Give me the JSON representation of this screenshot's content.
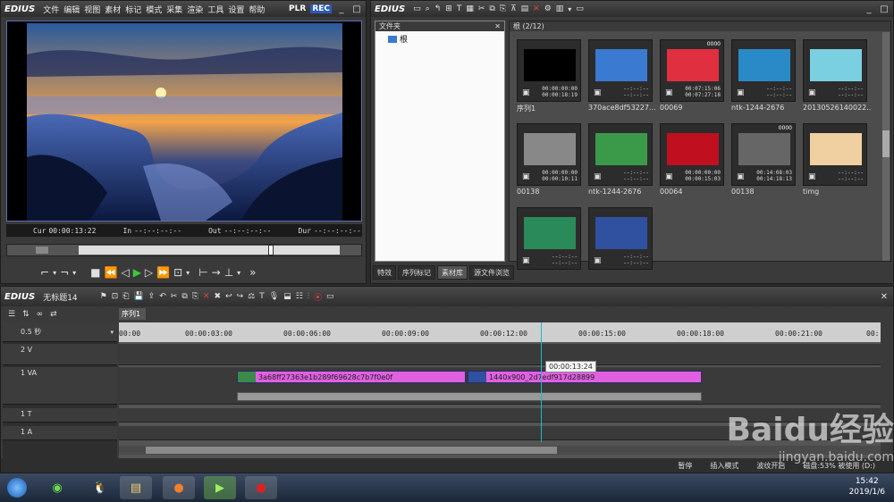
{
  "player": {
    "brand": "EDIUS",
    "menu": [
      "文件",
      "编辑",
      "视图",
      "素材",
      "标记",
      "模式",
      "采集",
      "渲染",
      "工具",
      "设置",
      "帮助"
    ],
    "plr": "PLR",
    "rec": "REC",
    "cur_label": "Cur",
    "cur_value": "00:00:13:22",
    "in_label": "In",
    "in_value": "--:--:--:--",
    "out_label": "Out",
    "out_value": "--:--:--:--",
    "dur_label": "Dur",
    "dur_value": "--:--:--:--"
  },
  "bin": {
    "brand": "EDIUS",
    "folder_header": "文件夹",
    "root_label": "根",
    "bin_header": "根 (2/12)",
    "clips": [
      {
        "name": "序列1",
        "tc1": "00:00:00:00",
        "tc2": "00:00:18:19",
        "corner": ""
      },
      {
        "name": "370ace8df53227...",
        "tc1": "--:--:--",
        "tc2": "--:--:--",
        "corner": ""
      },
      {
        "name": "00069",
        "tc1": "00:07:15:06",
        "tc2": "00:07:27:18",
        "corner": "0000"
      },
      {
        "name": "ntk-1244-2676",
        "tc1": "--:--:--",
        "tc2": "--:--:--",
        "corner": ""
      },
      {
        "name": "20130526140022...",
        "tc1": "--:--:--",
        "tc2": "--:--:--",
        "corner": ""
      },
      {
        "name": "00138",
        "tc1": "00:00:00:00",
        "tc2": "00:00:10:11",
        "corner": ""
      },
      {
        "name": "ntk-1244-2676",
        "tc1": "--:--:--",
        "tc2": "--:--:--",
        "corner": ""
      },
      {
        "name": "00064",
        "tc1": "00:00:00:00",
        "tc2": "00:00:15:03",
        "corner": ""
      },
      {
        "name": "00138",
        "tc1": "00:14:08:03",
        "tc2": "00:14:18:13",
        "corner": "0000"
      },
      {
        "name": "timg",
        "tc1": "--:--:--",
        "tc2": "--:--:--",
        "corner": ""
      },
      {
        "name": "",
        "tc1": "--:--:--",
        "tc2": "--:--:--",
        "corner": ""
      },
      {
        "name": "",
        "tc1": "--:--:--",
        "tc2": "--:--:--",
        "corner": ""
      }
    ],
    "tabs": [
      "特效",
      "序列标记",
      "素材库",
      "源文件浏览"
    ]
  },
  "timeline": {
    "brand": "EDIUS",
    "project": "无标题14",
    "sequence_tab": "序列1",
    "zoom": "0.5 秒",
    "ruler": [
      "00:00",
      "00:00:03:00",
      "00:00:06:00",
      "00:00:09:00",
      "00:00:12:00",
      "00:00:15:00",
      "00:00:18:00",
      "00:00:21:00",
      "00:"
    ],
    "tracks": [
      "2 V",
      "1 VA",
      "1 T",
      "1 A"
    ],
    "clip1": "3a68ff27363e1b289f69628c7b7f0e0f",
    "clip2": "1440x900_2d7edf917d28899",
    "tooltip": "00:00:13:24",
    "status_pause": "暂停",
    "status_insert": "插入模式",
    "status_ripple": "波纹开启",
    "status_disk": "磁盘:53% 被使用 (D:)"
  },
  "taskbar": {
    "time": "15:42",
    "date": "2019/1/6"
  },
  "watermark": {
    "main": "Baidu经验",
    "sub": "jingyan.baidu.com"
  }
}
